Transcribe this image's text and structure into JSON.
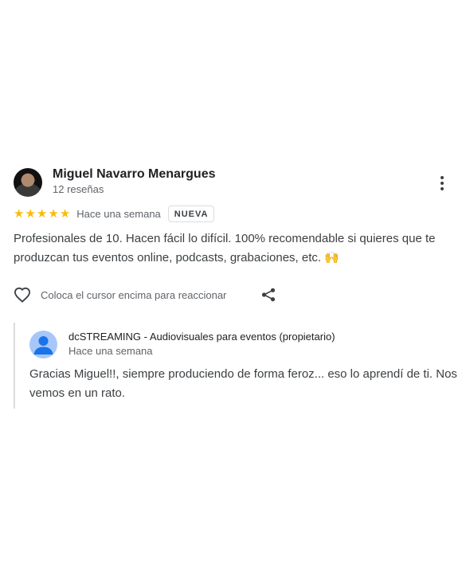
{
  "review": {
    "author_name": "Miguel Navarro Menargues",
    "author_meta": "12 reseñas",
    "rating": 5,
    "rating_stars": [
      "★",
      "★",
      "★",
      "★",
      "★"
    ],
    "date": "Hace una semana",
    "badge": "NUEVA",
    "text": "Profesionales de 10. Hacen fácil lo difícil. 100% recomendable si quieres que te produzcan tus eventos online, podcasts, grabaciones, etc. 🙌",
    "react_label": "Coloca el cursor encima para reaccionar",
    "icons": {
      "more": "more-vert-icon",
      "heart": "heart-icon",
      "share": "share-icon",
      "star": "star-icon"
    },
    "star_color": "#fbbc04"
  },
  "owner_response": {
    "name": "dcSTREAMING - Audiovisuales para eventos (propietario)",
    "date": "Hace una semana",
    "text": "Gracias Miguel!!, siempre produciendo de forma feroz... eso lo aprendí de ti. Nos vemos en un rato.",
    "avatar_color": "#a7c7fa",
    "avatar_icon_color": "#1a73e8"
  }
}
